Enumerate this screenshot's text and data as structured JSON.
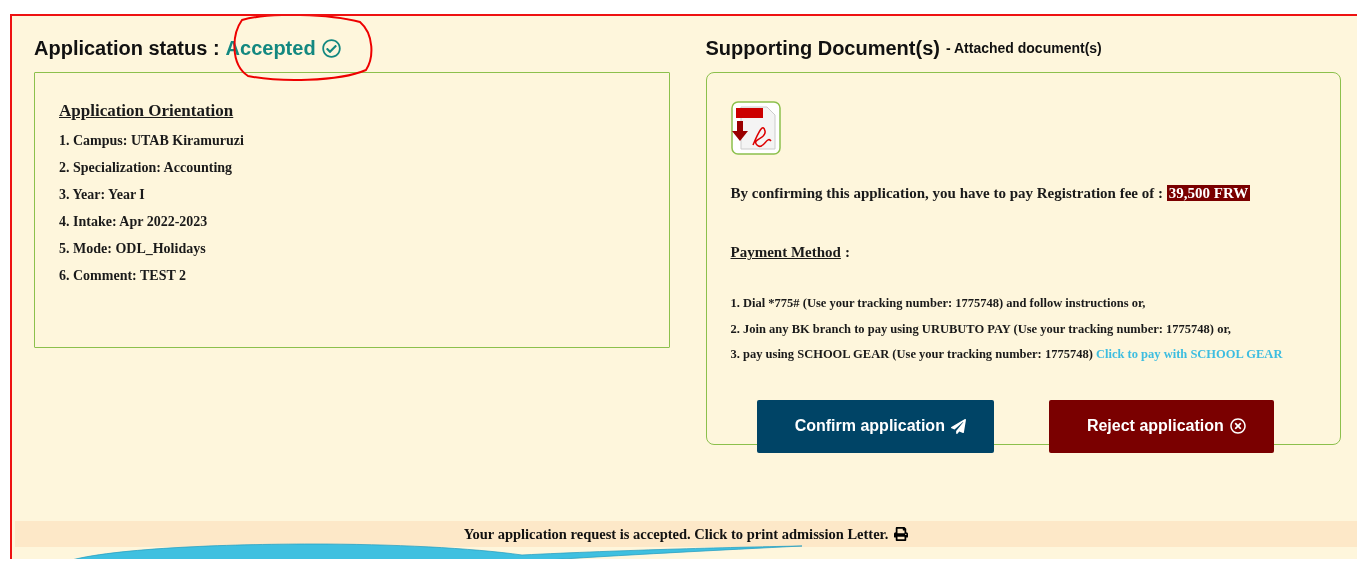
{
  "status": {
    "label": "Application status :",
    "value": "Accepted"
  },
  "orientation": {
    "title": "Application Orientation",
    "items": [
      "1. Campus: UTAB Kiramuruzi",
      "2. Specialization: Accounting",
      "3. Year: Year I",
      "4. Intake: Apr 2022-2023",
      "5. Mode: ODL_Holidays",
      "6. Comment: TEST 2"
    ]
  },
  "documents": {
    "title": "Supporting Document(s)",
    "subtitle": "- Attached document(s)"
  },
  "fee": {
    "text": "By confirming this application, you have to pay Registration fee of :",
    "amount": "39,500 FRW"
  },
  "payment": {
    "title": "Payment Method",
    "colon": ":",
    "methods": [
      {
        "text": "1. Dial *775# (Use your tracking number: 1775748) and follow instructions or,"
      },
      {
        "text": "2. Join any BK branch to pay using URUBUTO PAY (Use your tracking number: 1775748) or,"
      },
      {
        "text": "3. pay using SCHOOL GEAR (Use your tracking number: 1775748)",
        "link": "Click to pay with SCHOOL GEAR"
      }
    ]
  },
  "buttons": [
    {
      "kind": "confirm",
      "label": "Confirm application"
    },
    {
      "kind": "reject",
      "label": "Reject application"
    }
  ],
  "footer": {
    "text": "Your application request is accepted. Click to print admission Letter."
  }
}
